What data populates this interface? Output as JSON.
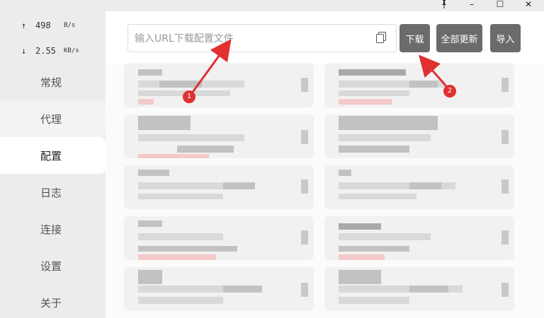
{
  "titlebar": {
    "pin_icon": "pin-icon",
    "minimize_glyph": "–",
    "maximize_glyph": "☐",
    "close_glyph": "✕"
  },
  "traffic": {
    "up_arrow": "↑",
    "up_value": "498",
    "up_unit": "B/s",
    "down_arrow": "↓",
    "down_value": "2.55",
    "down_unit": "KB/s"
  },
  "nav": [
    {
      "label": "常规"
    },
    {
      "label": "代理"
    },
    {
      "label": "配置"
    },
    {
      "label": "日志"
    },
    {
      "label": "连接"
    },
    {
      "label": "设置"
    },
    {
      "label": "关于"
    }
  ],
  "url_input": {
    "placeholder": "输入URL下载配置文件",
    "value": ""
  },
  "buttons": {
    "download": "下载",
    "update_all": "全部更新",
    "import": "导入"
  },
  "annotations": {
    "badge1": "1",
    "badge2": "2",
    "color": "#e03030"
  },
  "colors": {
    "button_bg": "#6b6b6b",
    "active_nav_bg": "#ffffff",
    "annotation_red": "#e03030"
  }
}
